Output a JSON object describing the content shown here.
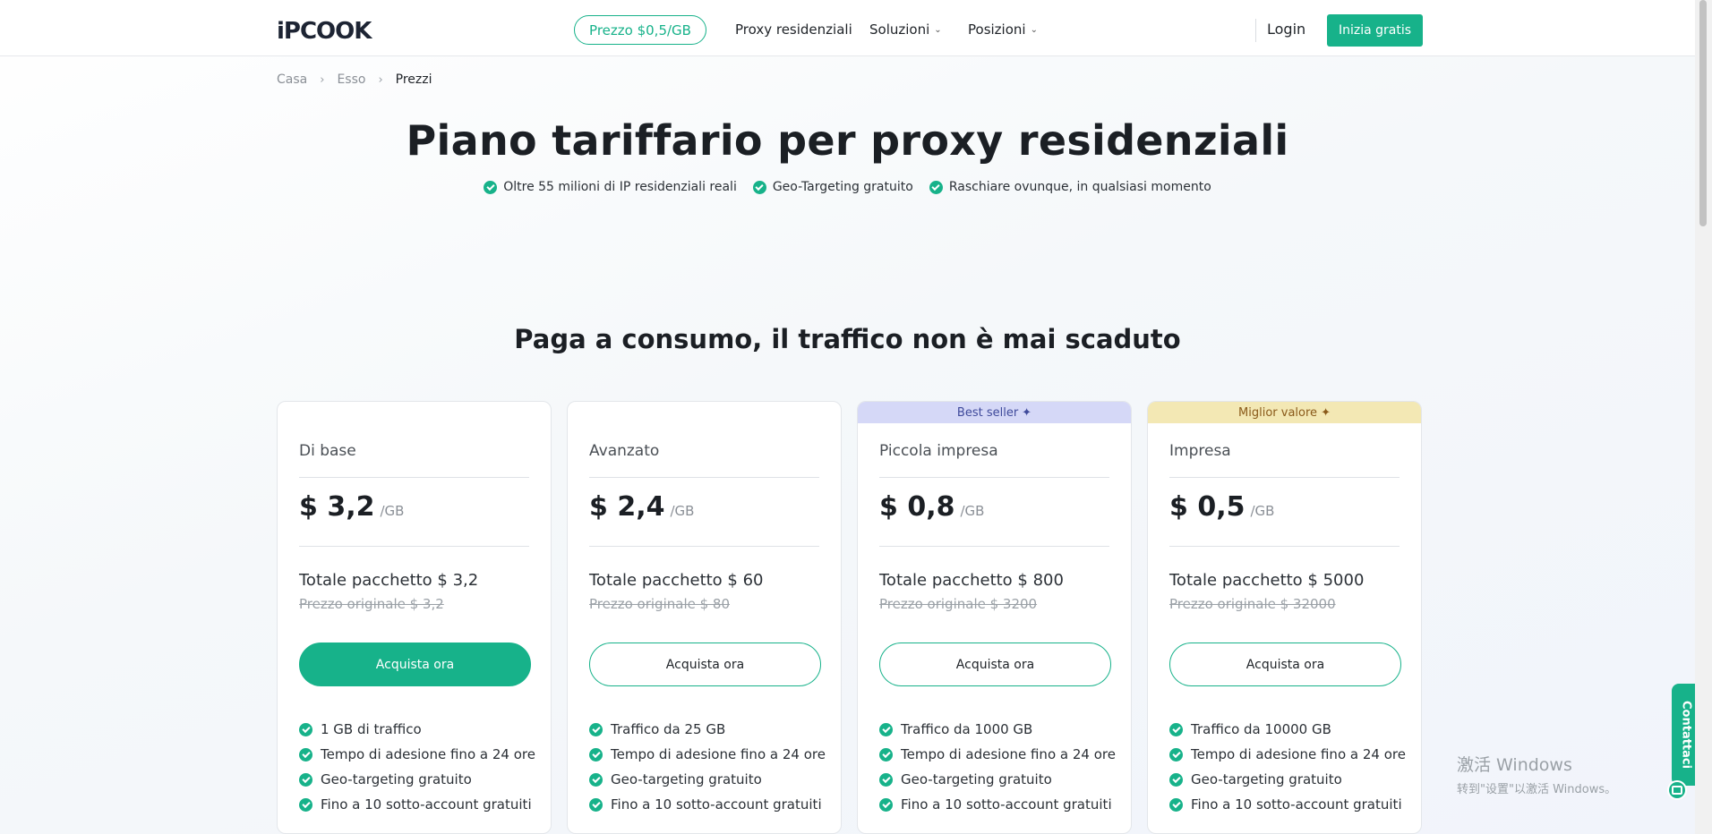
{
  "header": {
    "logo": "iPCOOK",
    "price_pill": "Prezzo $0,5/GB",
    "nav": [
      {
        "label": "Proxy residenziali",
        "dropdown": false
      },
      {
        "label": "Soluzioni",
        "dropdown": true
      },
      {
        "label": "Posizioni",
        "dropdown": true
      }
    ],
    "login": "Login",
    "start": "Inizia gratis"
  },
  "breadcrumb": [
    "Casa",
    "Esso",
    "Prezzi"
  ],
  "hero": {
    "title": "Piano tariffario per proxy residenziali",
    "features": [
      "Oltre 55 milioni di IP residenziali reali",
      "Geo-Targeting gratuito",
      "Raschiare ovunque, in qualsiasi momento"
    ]
  },
  "section_title": "Paga a consumo, il traffico non è mai scaduto",
  "plans": [
    {
      "ribbon": "",
      "name": "Di base",
      "price": "$ 3,2",
      "unit": "/GB",
      "total": "Totale pacchetto $ 3,2",
      "original": "Prezzo originale $ 3,2",
      "button": "Acquista ora",
      "features": [
        "1 GB di traffico",
        "Tempo di adesione fino a 24 ore",
        "Geo-targeting gratuito",
        "Fino a 10 sotto-account gratuiti"
      ]
    },
    {
      "ribbon": "",
      "name": "Avanzato",
      "price": "$ 2,4",
      "unit": "/GB",
      "total": "Totale pacchetto $ 60",
      "original": "Prezzo originale $ 80",
      "button": "Acquista ora",
      "features": [
        "Traffico da 25 GB",
        "Tempo di adesione fino a 24 ore",
        "Geo-targeting gratuito",
        "Fino a 10 sotto-account gratuiti"
      ]
    },
    {
      "ribbon": "Best seller",
      "name": "Piccola impresa",
      "price": "$ 0,8",
      "unit": "/GB",
      "total": "Totale pacchetto $ 800",
      "original": "Prezzo originale $ 3200",
      "button": "Acquista ora",
      "features": [
        "Traffico da 1000 GB",
        "Tempo di adesione fino a 24 ore",
        "Geo-targeting gratuito",
        "Fino a 10 sotto-account gratuiti"
      ]
    },
    {
      "ribbon": "Miglior valore",
      "name": "Impresa",
      "price": "$ 0,5",
      "unit": "/GB",
      "total": "Totale pacchetto $ 5000",
      "original": "Prezzo originale $ 32000",
      "button": "Acquista ora",
      "features": [
        "Traffico da 10000 GB",
        "Tempo di adesione fino a 24 ore",
        "Geo-targeting gratuito",
        "Fino a 10 sotto-account gratuiti"
      ]
    }
  ],
  "contact": "Contattaci",
  "watermark": {
    "line1": "激活 Windows",
    "line2": "转到\"设置\"以激活 Windows。"
  },
  "colors": {
    "accent": "#17b28a",
    "ribbon_blue": "#d5d8f7",
    "ribbon_yellow": "#f3e8b4"
  }
}
